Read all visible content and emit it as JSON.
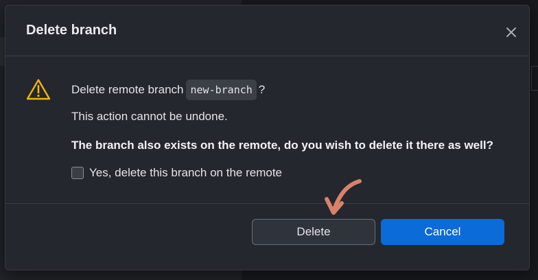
{
  "dialog": {
    "title": "Delete branch",
    "close_icon": "close-icon",
    "warning_icon": "warning-triangle-icon",
    "message_prefix": "Delete remote branch",
    "branch_name": "new-branch",
    "message_suffix": "?",
    "undone_text": "This action cannot be undone.",
    "remote_question": "The branch also exists on the remote, do you wish to delete it there as well?",
    "checkbox_label": "Yes, delete this branch on the remote",
    "checkbox_checked": false,
    "delete_label": "Delete",
    "cancel_label": "Cancel"
  },
  "colors": {
    "accent": "#0b6bd9",
    "warning": "#f2b705",
    "annotation_arrow": "#d9826a"
  }
}
